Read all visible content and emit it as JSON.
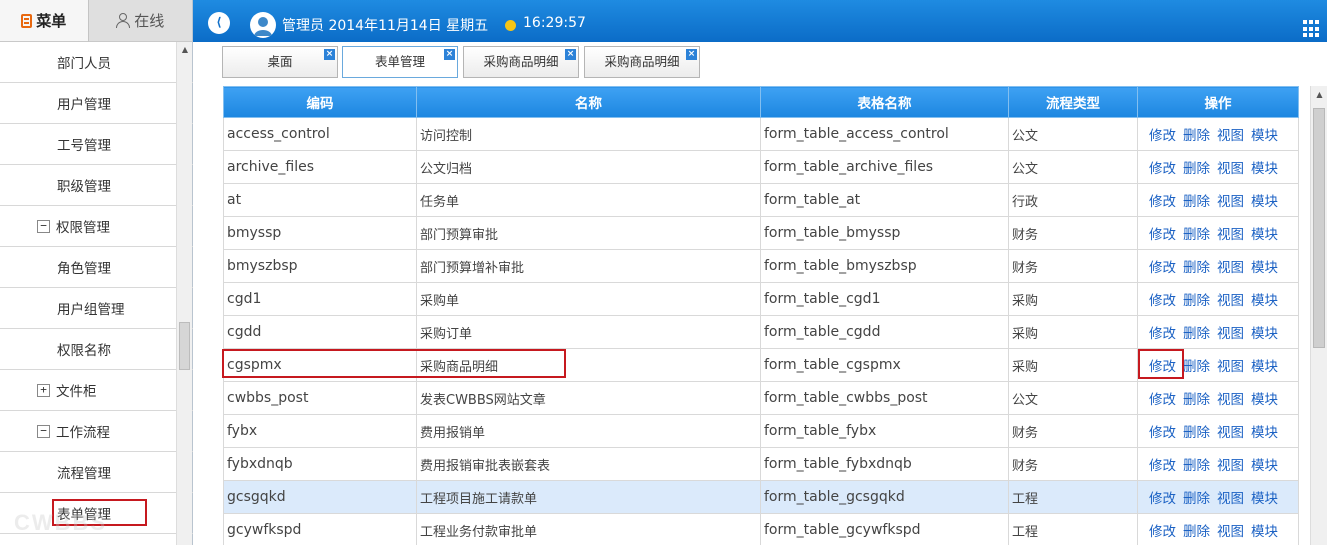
{
  "left_tabs": {
    "menu": "菜单",
    "online": "在线"
  },
  "menu": [
    {
      "label": "部门人员",
      "level": 2
    },
    {
      "label": "用户管理",
      "level": 2
    },
    {
      "label": "工号管理",
      "level": 2
    },
    {
      "label": "职级管理",
      "level": 2
    },
    {
      "label": "权限管理",
      "level": 1,
      "toggle": "−"
    },
    {
      "label": "角色管理",
      "level": 2
    },
    {
      "label": "用户组管理",
      "level": 2
    },
    {
      "label": "权限名称",
      "level": 2
    },
    {
      "label": "文件柜",
      "level": 1,
      "toggle": "+"
    },
    {
      "label": "工作流程",
      "level": 1,
      "toggle": "−"
    },
    {
      "label": "流程管理",
      "level": 2
    },
    {
      "label": "表单管理",
      "level": 2,
      "highlighted": true
    }
  ],
  "header": {
    "user_info": "管理员 2014年11月14日 星期五",
    "time": "16:29:57"
  },
  "tabs": [
    {
      "label": "桌面",
      "active": false
    },
    {
      "label": "表单管理",
      "active": true
    },
    {
      "label": "采购商品明细",
      "active": false
    },
    {
      "label": "采购商品明细",
      "active": false
    }
  ],
  "table": {
    "columns": [
      "编码",
      "名称",
      "表格名称",
      "流程类型",
      "操作"
    ],
    "actions": [
      "修改",
      "删除",
      "视图",
      "模块"
    ],
    "rows": [
      {
        "code": "access_control",
        "name": "访问控制",
        "table": "form_table_access_control",
        "type": "公文"
      },
      {
        "code": "archive_files",
        "name": "公文归档",
        "table": "form_table_archive_files",
        "type": "公文"
      },
      {
        "code": "at",
        "name": "任务单",
        "table": "form_table_at",
        "type": "行政"
      },
      {
        "code": "bmyssp",
        "name": "部门预算审批",
        "table": "form_table_bmyssp",
        "type": "财务"
      },
      {
        "code": "bmyszbsp",
        "name": "部门预算增补审批",
        "table": "form_table_bmyszbsp",
        "type": "财务"
      },
      {
        "code": "cgd1",
        "name": "采购单",
        "table": "form_table_cgd1",
        "type": "采购"
      },
      {
        "code": "cgdd",
        "name": "采购订单",
        "table": "form_table_cgdd",
        "type": "采购"
      },
      {
        "code": "cgspmx",
        "name": "采购商品明细",
        "table": "form_table_cgspmx",
        "type": "采购",
        "highlighted": true
      },
      {
        "code": "cwbbs_post",
        "name": "发表CWBBS网站文章",
        "table": "form_table_cwbbs_post",
        "type": "公文"
      },
      {
        "code": "fybx",
        "name": "费用报销单",
        "table": "form_table_fybx",
        "type": "财务"
      },
      {
        "code": "fybxdnqb",
        "name": "费用报销审批表嵌套表",
        "table": "form_table_fybxdnqb",
        "type": "财务"
      },
      {
        "code": "gcsgqkd",
        "name": "工程项目施工请款单",
        "table": "form_table_gcsgqkd",
        "type": "工程",
        "selected": true
      },
      {
        "code": "gcywfkspd",
        "name": "工程业务付款审批单",
        "table": "form_table_gcywfkspd",
        "type": "工程"
      }
    ]
  },
  "watermark": "CWBBS",
  "colors": {
    "header_blue": "#1f8be1",
    "table_header": "#2a90e8",
    "link": "#1c62c4",
    "highlight_red": "#c6191f",
    "selected_row": "#dbeafb"
  }
}
